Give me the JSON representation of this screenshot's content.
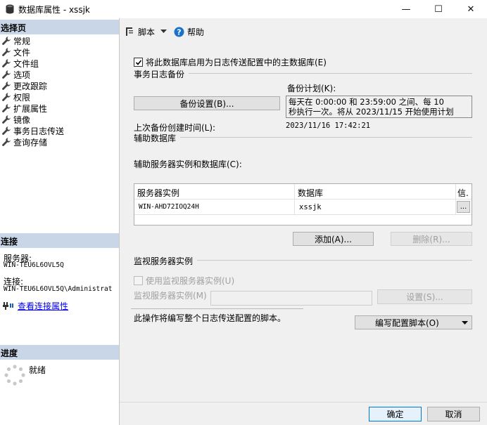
{
  "window": {
    "title": "数据库属性 - xssjk",
    "minimize": "—",
    "maximize": "☐",
    "close": "✕"
  },
  "sidebar": {
    "select_page_header": "选择页",
    "items": [
      {
        "label": "常规"
      },
      {
        "label": "文件"
      },
      {
        "label": "文件组"
      },
      {
        "label": "选项"
      },
      {
        "label": "更改跟踪"
      },
      {
        "label": "权限"
      },
      {
        "label": "扩展属性"
      },
      {
        "label": "镜像"
      },
      {
        "label": "事务日志传送"
      },
      {
        "label": "查询存储"
      }
    ],
    "connection_header": "连接",
    "server_label": "服务器:",
    "server_value": "WIN-TEU6L6OVL5Q",
    "connection_label": "连接:",
    "connection_value": "WIN-TEU6L6OVL5Q\\Administrat",
    "view_connection_props": "查看连接属性",
    "progress_header": "进度",
    "progress_status": "就绪"
  },
  "toolbar": {
    "script_label": "脚本",
    "help_label": "帮助"
  },
  "main": {
    "enable_primary_checkbox_label": "将此数据库启用为日志传送配置中的主数据库(E)",
    "enable_primary_checked": true,
    "tx_log_backup_title": "事务日志备份",
    "backup_settings_button": "备份设置(B)...",
    "backup_schedule_label": "备份计划(K):",
    "backup_schedule_text": [
      "每天在 0:00:00 和 23:59:00 之间、每 10",
      "秒执行一次。将从 2023/11/15 开始使用计划"
    ],
    "last_backup_label": "上次备份创建时间(L):",
    "last_backup_value": "2023/11/16 17:42:21",
    "secondary_db_title": "辅助数据库",
    "secondary_instances_label": "辅助服务器实例和数据库(C):",
    "grid": {
      "headers": [
        "服务器实例",
        "数据库",
        "信."
      ],
      "rows": [
        {
          "server": "WIN-AHD72IOQ24H",
          "database": "xssjk",
          "action": "..."
        }
      ]
    },
    "add_button": "添加(A)...",
    "remove_button": "删除(R)...",
    "monitor_title": "监视服务器实例",
    "use_monitor_checkbox_label": "使用监视服务器实例(U)",
    "use_monitor_checked": false,
    "monitor_instance_label": "监视服务器实例(M)",
    "monitor_instance_value": "",
    "monitor_settings_button": "设置(S)...",
    "script_note": "此操作将编写整个日志传送配置的脚本。",
    "script_config_button": "编写配置脚本(O)"
  },
  "footer": {
    "ok_button": "确定",
    "cancel_button": "取消"
  },
  "colors": {
    "section_header_bg": "#c9d6e8",
    "link": "#0000ee",
    "help_icon": "#1a73c9",
    "primary_border": "#0078d7"
  }
}
